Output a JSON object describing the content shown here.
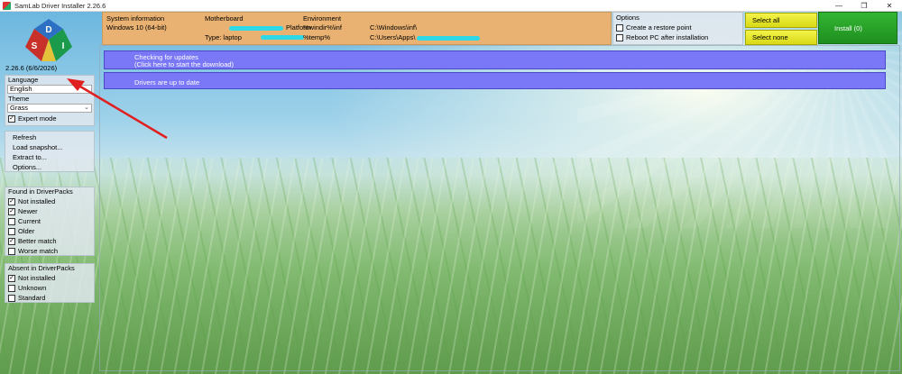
{
  "window": {
    "title": "SamLab Driver Installer 2.26.6",
    "minimize_icon": "minimize-icon",
    "maximize_icon": "restore-icon",
    "close_icon": "close-icon"
  },
  "sidebar": {
    "version": "2.26.6 (6/6/2026)",
    "logo_letters": [
      "S",
      "D",
      "I"
    ],
    "language": {
      "label": "Language",
      "value": "English"
    },
    "theme": {
      "label": "Theme",
      "value": "Grass"
    },
    "expert_mode": {
      "label": "Expert mode",
      "checked": true
    },
    "actions": [
      "Refresh",
      "Load snapshot...",
      "Extract to...",
      "Options..."
    ],
    "found": {
      "label": "Found in DriverPacks",
      "items": [
        {
          "label": "Not installed",
          "checked": true
        },
        {
          "label": "Newer",
          "checked": true
        },
        {
          "label": "Current",
          "checked": false
        },
        {
          "label": "Older",
          "checked": false
        },
        {
          "label": "Better match",
          "checked": true
        },
        {
          "label": "Worse match",
          "checked": false
        }
      ]
    },
    "absent": {
      "label": "Absent in DriverPacks",
      "items": [
        {
          "label": "Not installed",
          "checked": true
        },
        {
          "label": "Unknown",
          "checked": false
        },
        {
          "label": "Standard",
          "checked": false
        }
      ]
    }
  },
  "info": {
    "system_label": "System information",
    "system_value": "Windows 10 (64-bit)",
    "motherboard_label": "Motherboard",
    "platform_label": "Platform",
    "type_value": "Type: laptop",
    "environment_label": "Environment",
    "windir_key": "%windir%\\inf",
    "windir_value": "C:\\Windows\\inf\\",
    "temp_key": "%temp%",
    "temp_value": "C:\\Users\\Apps\\"
  },
  "options": {
    "label": "Options",
    "restore_point": {
      "label": "Create a restore point",
      "checked": false
    },
    "reboot": {
      "label": "Reboot PC after installation",
      "checked": false
    }
  },
  "buttons": {
    "select_all": "Select all",
    "select_none": "Select none",
    "install": "Install (0)"
  },
  "status": {
    "updates_line1": "Checking for updates",
    "updates_line2": "(Click here to start the download)",
    "drivers": "Drivers are up to date"
  },
  "colors": {
    "info_bg": "#e9b272",
    "bar_bg": "#7a78f6",
    "install_bg": "#2aa42a",
    "select_bg": "#e6e62a",
    "arrow": "#e02020"
  }
}
